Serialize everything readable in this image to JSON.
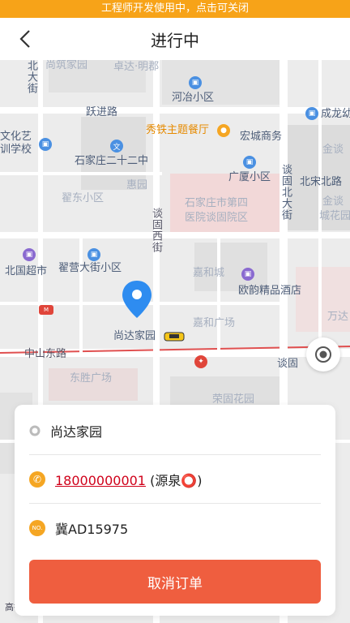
{
  "dev_banner": "工程师开发使用中，点击可关闭",
  "header": {
    "title": "进行中",
    "back_icon": "chevron-left-icon"
  },
  "map": {
    "labels": {
      "n1": "北大街",
      "n2": "尚筑家园",
      "n3": "卓达·明郡",
      "n4": "河冶小区",
      "n5": "跃进路",
      "n6": "成龙幼",
      "n7": "文化艺",
      "n8": "训学校",
      "n9": "秀铁主题餐厅",
      "n10": "宏城商务",
      "n11": "金谈",
      "n12": "石家庄二十二中",
      "n13": "广厦小区",
      "n14": "北宋北路",
      "n15": "惠园",
      "n16": "翟东小区",
      "n17": "石家庄市第四",
      "n18": "医院谈固院区",
      "n19": "金谈",
      "n20": "城花园",
      "n21": "谈固西街",
      "n22": "谈固北大街",
      "n23": "翟营大街小区",
      "n24": "北国超市",
      "n25": "嘉和城",
      "n26": "欧韵精品酒店",
      "n27": "万达",
      "n28": "嘉和广场",
      "n29": "尚达家园",
      "n30": "中山东路",
      "n31": "谈固",
      "n32": "东胜广场",
      "n33": "荣固花园",
      "n34": "谈固"
    },
    "amap_logo": "高德地图"
  },
  "order": {
    "pickup_address": "尚达家园",
    "phone": "18000000001",
    "passenger_tag": "(源泉⭕)",
    "plate": "冀AD15975",
    "plate_badge": "NO.",
    "cancel_label": "取消订单"
  },
  "colors": {
    "accent": "#f7a318",
    "cancel": "#ef5e3f",
    "link": "#d0021b"
  }
}
